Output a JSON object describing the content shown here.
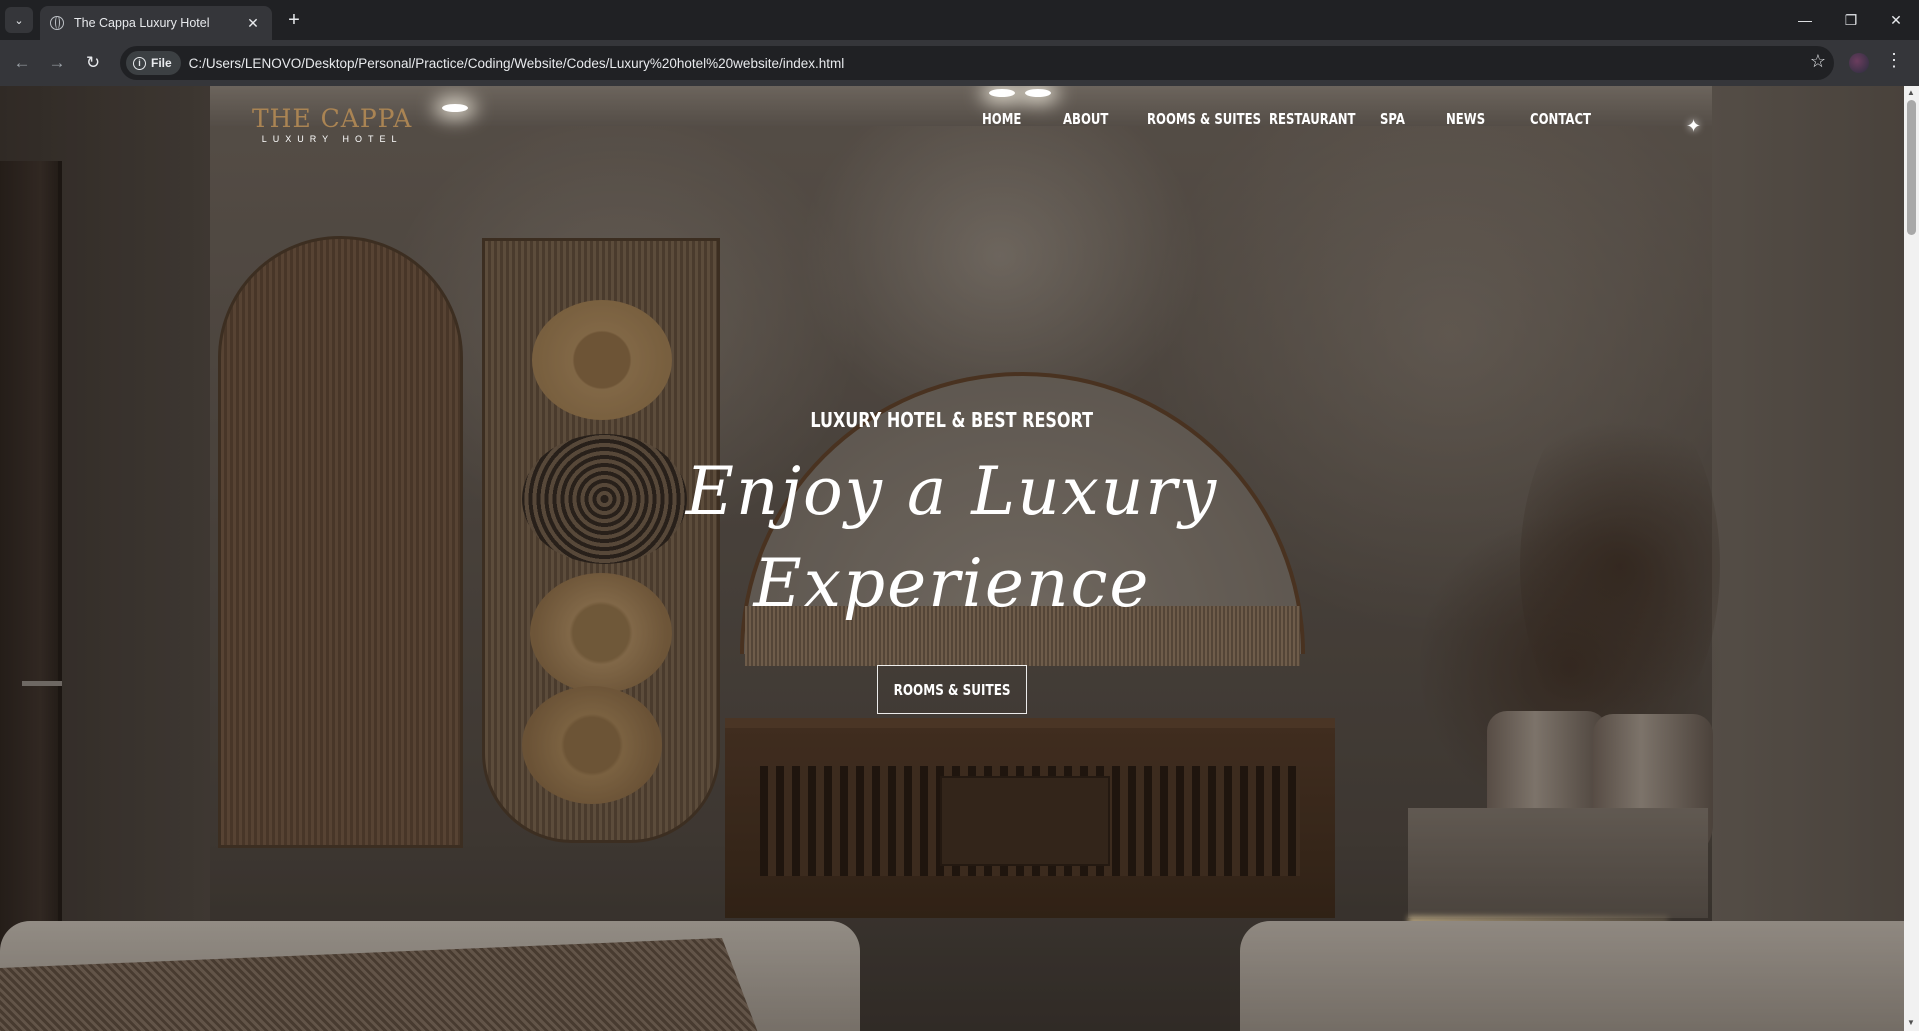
{
  "browser": {
    "tab_title": "The Cappa Luxury Hotel",
    "tab_close": "✕",
    "new_tab": "+",
    "chip_label": "File",
    "url": "C:/Users/LENOVO/Desktop/Personal/Practice/Coding/Website/Codes/Luxury%20hotel%20website/index.html",
    "icons": {
      "tab_menu": "chevron-down-icon",
      "back": "back-arrow-icon",
      "forward": "forward-arrow-icon",
      "reload": "reload-icon",
      "bookmark": "star-icon",
      "menu": "kebab-icon"
    }
  },
  "site": {
    "logo_main": "THE CAPPA",
    "logo_sub": "LUXURY HOTEL",
    "nav": [
      "HOME",
      "ABOUT",
      "ROOMS & SUITES",
      "RESTAURANT",
      "SPA",
      "NEWS",
      "CONTACT"
    ],
    "hero_subtitle": "LUXURY HOTEL & BEST RESORT",
    "hero_title_line1": "Enjoy a Luxury",
    "hero_title_line2": "Experience",
    "hero_button": "ROOMS & SUITES",
    "colors": {
      "logo": "#aa8453",
      "text": "#ffffff"
    }
  }
}
